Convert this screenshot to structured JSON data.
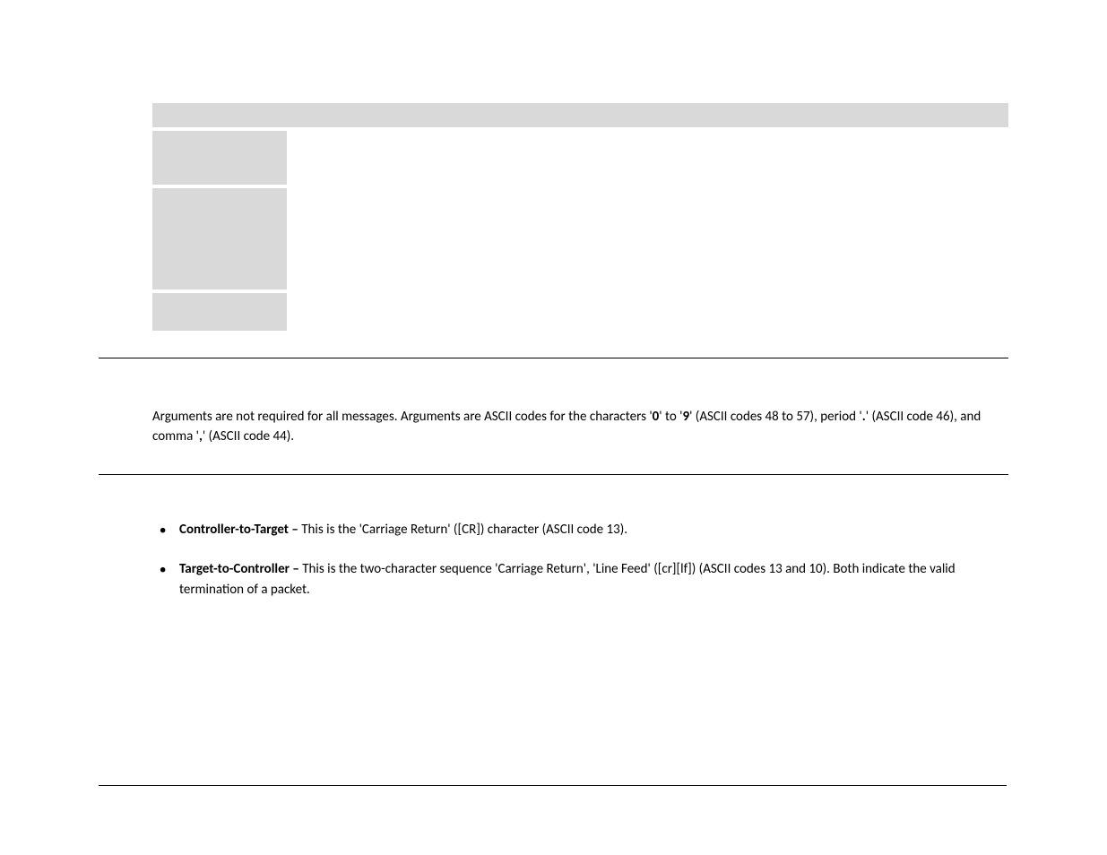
{
  "arguments_text": {
    "part1": "Arguments are not required for all messages. Arguments are ASCII codes for the characters '",
    "zero": "0",
    "part2": "' to '",
    "nine": "9",
    "part3": "' (ASCII codes 48 to 57), period '",
    "period": ".",
    "part4": "' (ASCII code 46), and comma '",
    "comma": ",",
    "part5": "' (ASCII code 44)."
  },
  "bullets": [
    {
      "label": "Controller-to-Target – ",
      "text": " This is the 'Carriage Return' ([CR]) character (ASCII code 13)."
    },
    {
      "label": "Target-to-Controller – ",
      "text": "This is the two-character sequence 'Carriage Return', 'Line Feed' ([cr][lf]) (ASCII codes 13 and 10).  Both indicate the valid termination of a packet."
    }
  ]
}
